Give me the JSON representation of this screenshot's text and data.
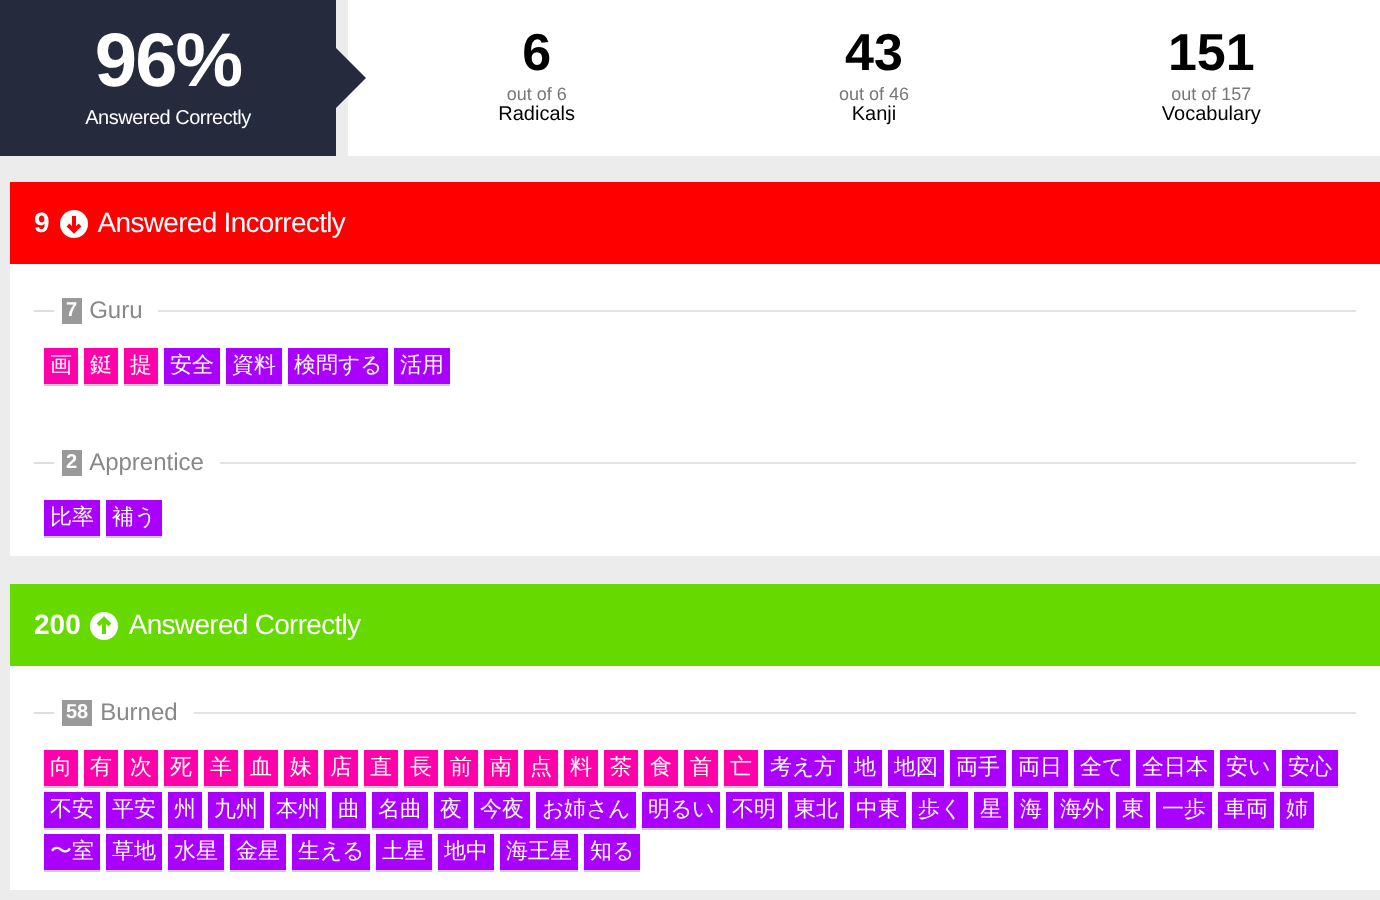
{
  "summary": {
    "percent": "96%",
    "label": "Answered Correctly"
  },
  "stats": [
    {
      "value": "6",
      "out_of": "out of 6",
      "label": "Radicals"
    },
    {
      "value": "43",
      "out_of": "out of 46",
      "label": "Kanji"
    },
    {
      "value": "151",
      "out_of": "out of 157",
      "label": "Vocabulary"
    }
  ],
  "sections": [
    {
      "kind": "incorrect",
      "count": "9",
      "title": "Answered Incorrectly",
      "groups": [
        {
          "count": "7",
          "name": "Guru",
          "items": [
            {
              "text": "画",
              "kind": "kanji"
            },
            {
              "text": "鋌",
              "kind": "kanji"
            },
            {
              "text": "提",
              "kind": "kanji"
            },
            {
              "text": "安全",
              "kind": "vocabulary"
            },
            {
              "text": "資料",
              "kind": "vocabulary"
            },
            {
              "text": "検問する",
              "kind": "vocabulary"
            },
            {
              "text": "活用",
              "kind": "vocabulary"
            }
          ]
        },
        {
          "count": "2",
          "name": "Apprentice",
          "items": [
            {
              "text": "比率",
              "kind": "vocabulary"
            },
            {
              "text": "補う",
              "kind": "vocabulary"
            }
          ]
        }
      ]
    },
    {
      "kind": "correct",
      "count": "200",
      "title": "Answered Correctly",
      "groups": [
        {
          "count": "58",
          "name": "Burned",
          "items": [
            {
              "text": "向",
              "kind": "kanji"
            },
            {
              "text": "有",
              "kind": "kanji"
            },
            {
              "text": "次",
              "kind": "kanji"
            },
            {
              "text": "死",
              "kind": "kanji"
            },
            {
              "text": "羊",
              "kind": "kanji"
            },
            {
              "text": "血",
              "kind": "kanji"
            },
            {
              "text": "妹",
              "kind": "kanji"
            },
            {
              "text": "店",
              "kind": "kanji"
            },
            {
              "text": "直",
              "kind": "kanji"
            },
            {
              "text": "長",
              "kind": "kanji"
            },
            {
              "text": "前",
              "kind": "kanji"
            },
            {
              "text": "南",
              "kind": "kanji"
            },
            {
              "text": "点",
              "kind": "kanji"
            },
            {
              "text": "料",
              "kind": "kanji"
            },
            {
              "text": "茶",
              "kind": "kanji"
            },
            {
              "text": "食",
              "kind": "kanji"
            },
            {
              "text": "首",
              "kind": "kanji"
            },
            {
              "text": "亡",
              "kind": "kanji"
            },
            {
              "text": "考え方",
              "kind": "vocabulary"
            },
            {
              "text": "地",
              "kind": "vocabulary"
            },
            {
              "text": "地図",
              "kind": "vocabulary"
            },
            {
              "text": "両手",
              "kind": "vocabulary"
            },
            {
              "text": "両日",
              "kind": "vocabulary"
            },
            {
              "text": "全て",
              "kind": "vocabulary"
            },
            {
              "text": "全日本",
              "kind": "vocabulary"
            },
            {
              "text": "安い",
              "kind": "vocabulary"
            },
            {
              "text": "安心",
              "kind": "vocabulary"
            },
            {
              "text": "不安",
              "kind": "vocabulary"
            },
            {
              "text": "平安",
              "kind": "vocabulary"
            },
            {
              "text": "州",
              "kind": "vocabulary"
            },
            {
              "text": "九州",
              "kind": "vocabulary"
            },
            {
              "text": "本州",
              "kind": "vocabulary"
            },
            {
              "text": "曲",
              "kind": "vocabulary"
            },
            {
              "text": "名曲",
              "kind": "vocabulary"
            },
            {
              "text": "夜",
              "kind": "vocabulary"
            },
            {
              "text": "今夜",
              "kind": "vocabulary"
            },
            {
              "text": "お姉さん",
              "kind": "vocabulary"
            },
            {
              "text": "明るい",
              "kind": "vocabulary"
            },
            {
              "text": "不明",
              "kind": "vocabulary"
            },
            {
              "text": "東北",
              "kind": "vocabulary"
            },
            {
              "text": "中東",
              "kind": "vocabulary"
            },
            {
              "text": "歩く",
              "kind": "vocabulary"
            },
            {
              "text": "星",
              "kind": "vocabulary"
            },
            {
              "text": "海",
              "kind": "vocabulary"
            },
            {
              "text": "海外",
              "kind": "vocabulary"
            },
            {
              "text": "東",
              "kind": "vocabulary"
            },
            {
              "text": "一歩",
              "kind": "vocabulary"
            },
            {
              "text": "車両",
              "kind": "vocabulary"
            },
            {
              "text": "姉",
              "kind": "vocabulary"
            },
            {
              "text": "〜室",
              "kind": "vocabulary"
            },
            {
              "text": "草地",
              "kind": "vocabulary"
            },
            {
              "text": "水星",
              "kind": "vocabulary"
            },
            {
              "text": "金星",
              "kind": "vocabulary"
            },
            {
              "text": "生える",
              "kind": "vocabulary"
            },
            {
              "text": "土星",
              "kind": "vocabulary"
            },
            {
              "text": "地中",
              "kind": "vocabulary"
            },
            {
              "text": "海王星",
              "kind": "vocabulary"
            },
            {
              "text": "知る",
              "kind": "vocabulary"
            }
          ]
        }
      ]
    }
  ]
}
